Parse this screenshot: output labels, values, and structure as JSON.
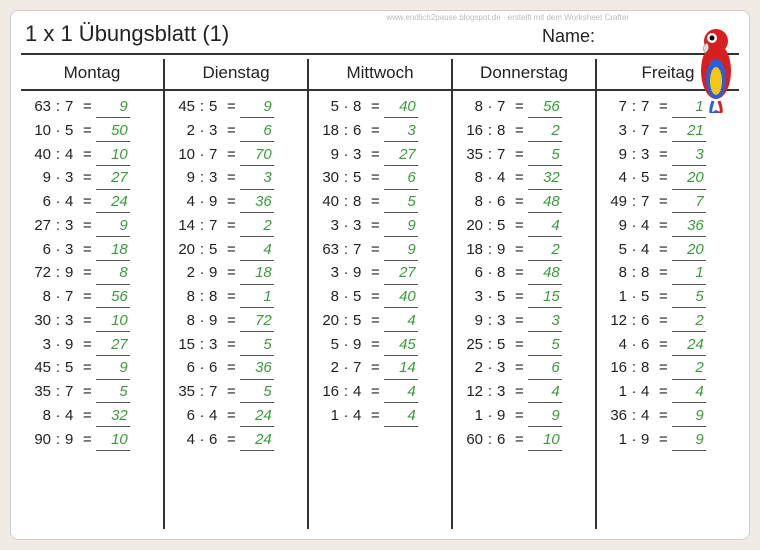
{
  "header": {
    "title": "1 x 1 Übungsblatt (1)",
    "name_label": "Name:",
    "watermark_top": "www.endlich2pause.blogspot.de · erstellt mit dem Worksheet Crafter"
  },
  "days": [
    {
      "label": "Montag",
      "problems": [
        {
          "a": "63",
          "op": ":",
          "b": "7",
          "ans": "9"
        },
        {
          "a": "10",
          "op": "·",
          "b": "5",
          "ans": "50"
        },
        {
          "a": "40",
          "op": ":",
          "b": "4",
          "ans": "10"
        },
        {
          "a": "9",
          "op": "·",
          "b": "3",
          "ans": "27"
        },
        {
          "a": "6",
          "op": "·",
          "b": "4",
          "ans": "24"
        },
        {
          "a": "27",
          "op": ":",
          "b": "3",
          "ans": "9"
        },
        {
          "a": "6",
          "op": "·",
          "b": "3",
          "ans": "18"
        },
        {
          "a": "72",
          "op": ":",
          "b": "9",
          "ans": "8"
        },
        {
          "a": "8",
          "op": "·",
          "b": "7",
          "ans": "56"
        },
        {
          "a": "30",
          "op": ":",
          "b": "3",
          "ans": "10"
        },
        {
          "a": "3",
          "op": "·",
          "b": "9",
          "ans": "27"
        },
        {
          "a": "45",
          "op": ":",
          "b": "5",
          "ans": "9"
        },
        {
          "a": "35",
          "op": ":",
          "b": "7",
          "ans": "5"
        },
        {
          "a": "8",
          "op": "·",
          "b": "4",
          "ans": "32"
        },
        {
          "a": "90",
          "op": ":",
          "b": "9",
          "ans": "10"
        }
      ]
    },
    {
      "label": "Dienstag",
      "problems": [
        {
          "a": "45",
          "op": ":",
          "b": "5",
          "ans": "9"
        },
        {
          "a": "2",
          "op": "·",
          "b": "3",
          "ans": "6"
        },
        {
          "a": "10",
          "op": "·",
          "b": "7",
          "ans": "70"
        },
        {
          "a": "9",
          "op": ":",
          "b": "3",
          "ans": "3"
        },
        {
          "a": "4",
          "op": "·",
          "b": "9",
          "ans": "36"
        },
        {
          "a": "14",
          "op": ":",
          "b": "7",
          "ans": "2"
        },
        {
          "a": "20",
          "op": ":",
          "b": "5",
          "ans": "4"
        },
        {
          "a": "2",
          "op": "·",
          "b": "9",
          "ans": "18"
        },
        {
          "a": "8",
          "op": ":",
          "b": "8",
          "ans": "1"
        },
        {
          "a": "8",
          "op": "·",
          "b": "9",
          "ans": "72"
        },
        {
          "a": "15",
          "op": ":",
          "b": "3",
          "ans": "5"
        },
        {
          "a": "6",
          "op": "·",
          "b": "6",
          "ans": "36"
        },
        {
          "a": "35",
          "op": ":",
          "b": "7",
          "ans": "5"
        },
        {
          "a": "6",
          "op": "·",
          "b": "4",
          "ans": "24"
        },
        {
          "a": "4",
          "op": "·",
          "b": "6",
          "ans": "24"
        }
      ]
    },
    {
      "label": "Mittwoch",
      "problems": [
        {
          "a": "5",
          "op": "·",
          "b": "8",
          "ans": "40"
        },
        {
          "a": "18",
          "op": ":",
          "b": "6",
          "ans": "3"
        },
        {
          "a": "9",
          "op": "·",
          "b": "3",
          "ans": "27"
        },
        {
          "a": "30",
          "op": ":",
          "b": "5",
          "ans": "6"
        },
        {
          "a": "40",
          "op": ":",
          "b": "8",
          "ans": "5"
        },
        {
          "a": "3",
          "op": "·",
          "b": "3",
          "ans": "9"
        },
        {
          "a": "63",
          "op": ":",
          "b": "7",
          "ans": "9"
        },
        {
          "a": "3",
          "op": "·",
          "b": "9",
          "ans": "27"
        },
        {
          "a": "8",
          "op": "·",
          "b": "5",
          "ans": "40"
        },
        {
          "a": "20",
          "op": ":",
          "b": "5",
          "ans": "4"
        },
        {
          "a": "5",
          "op": "·",
          "b": "9",
          "ans": "45"
        },
        {
          "a": "2",
          "op": "·",
          "b": "7",
          "ans": "14"
        },
        {
          "a": "16",
          "op": ":",
          "b": "4",
          "ans": "4"
        },
        {
          "a": "1",
          "op": "·",
          "b": "4",
          "ans": "4"
        }
      ]
    },
    {
      "label": "Donnerstag",
      "problems": [
        {
          "a": "8",
          "op": "·",
          "b": "7",
          "ans": "56"
        },
        {
          "a": "16",
          "op": ":",
          "b": "8",
          "ans": "2"
        },
        {
          "a": "35",
          "op": ":",
          "b": "7",
          "ans": "5"
        },
        {
          "a": "8",
          "op": "·",
          "b": "4",
          "ans": "32"
        },
        {
          "a": "8",
          "op": "·",
          "b": "6",
          "ans": "48"
        },
        {
          "a": "20",
          "op": ":",
          "b": "5",
          "ans": "4"
        },
        {
          "a": "18",
          "op": ":",
          "b": "9",
          "ans": "2"
        },
        {
          "a": "6",
          "op": "·",
          "b": "8",
          "ans": "48"
        },
        {
          "a": "3",
          "op": "·",
          "b": "5",
          "ans": "15"
        },
        {
          "a": "9",
          "op": ":",
          "b": "3",
          "ans": "3"
        },
        {
          "a": "25",
          "op": ":",
          "b": "5",
          "ans": "5"
        },
        {
          "a": "2",
          "op": "·",
          "b": "3",
          "ans": "6"
        },
        {
          "a": "12",
          "op": ":",
          "b": "3",
          "ans": "4"
        },
        {
          "a": "1",
          "op": "·",
          "b": "9",
          "ans": "9"
        },
        {
          "a": "60",
          "op": ":",
          "b": "6",
          "ans": "10"
        }
      ]
    },
    {
      "label": "Freitag",
      "problems": [
        {
          "a": "7",
          "op": ":",
          "b": "7",
          "ans": "1"
        },
        {
          "a": "3",
          "op": "·",
          "b": "7",
          "ans": "21"
        },
        {
          "a": "9",
          "op": ":",
          "b": "3",
          "ans": "3"
        },
        {
          "a": "4",
          "op": "·",
          "b": "5",
          "ans": "20"
        },
        {
          "a": "49",
          "op": ":",
          "b": "7",
          "ans": "7"
        },
        {
          "a": "9",
          "op": "·",
          "b": "4",
          "ans": "36"
        },
        {
          "a": "5",
          "op": "·",
          "b": "4",
          "ans": "20"
        },
        {
          "a": "8",
          "op": ":",
          "b": "8",
          "ans": "1"
        },
        {
          "a": "1",
          "op": "·",
          "b": "5",
          "ans": "5"
        },
        {
          "a": "12",
          "op": ":",
          "b": "6",
          "ans": "2"
        },
        {
          "a": "4",
          "op": "·",
          "b": "6",
          "ans": "24"
        },
        {
          "a": "16",
          "op": ":",
          "b": "8",
          "ans": "2"
        },
        {
          "a": "1",
          "op": "·",
          "b": "4",
          "ans": "4"
        },
        {
          "a": "36",
          "op": ":",
          "b": "4",
          "ans": "9"
        },
        {
          "a": "1",
          "op": "·",
          "b": "9",
          "ans": "9"
        }
      ]
    }
  ]
}
